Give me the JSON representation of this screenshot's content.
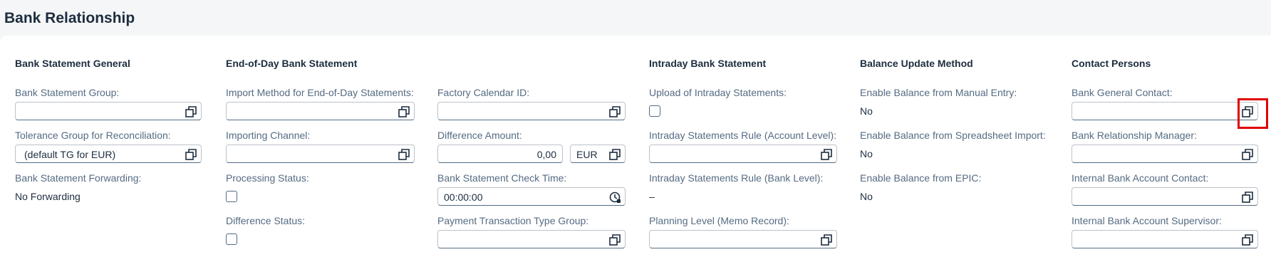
{
  "page": {
    "title": "Bank Relationship"
  },
  "sections": {
    "bank_statement_general": {
      "title": "Bank Statement General",
      "group_label": "Bank Statement Group:",
      "group_value": "",
      "tolerance_label": "Tolerance Group for Reconciliation:",
      "tolerance_value": "(default TG for EUR)",
      "forwarding_label": "Bank Statement Forwarding:",
      "forwarding_value": "No Forwarding"
    },
    "end_of_day": {
      "title": "End-of-Day Bank Statement",
      "import_method_label": "Import Method for End-of-Day Statements:",
      "import_method_value": "",
      "importing_channel_label": "Importing Channel:",
      "importing_channel_value": "",
      "processing_status_label": "Processing Status:",
      "difference_status_label": "Difference Status:",
      "factory_calendar_label": "Factory Calendar ID:",
      "factory_calendar_value": "",
      "difference_amount_label": "Difference Amount:",
      "difference_amount_value": "0,00",
      "currency_value": "EUR",
      "check_time_label": "Bank Statement Check Time:",
      "check_time_value": "00:00:00",
      "payment_type_group_label": "Payment Transaction Type Group:",
      "payment_type_group_value": ""
    },
    "intraday": {
      "title": "Intraday Bank Statement",
      "upload_label": "Upload of Intraday Statements:",
      "rule_account_label": "Intraday Statements Rule (Account Level):",
      "rule_account_value": "",
      "rule_bank_label": "Intraday Statements Rule (Bank Level):",
      "rule_bank_value": "–",
      "planning_level_label": "Planning Level (Memo Record):",
      "planning_level_value": ""
    },
    "balance_update": {
      "title": "Balance Update Method",
      "manual_label": "Enable Balance from Manual Entry:",
      "manual_value": "No",
      "spreadsheet_label": "Enable Balance from Spreadsheet Import:",
      "spreadsheet_value": "No",
      "epic_label": "Enable Balance from EPIC:",
      "epic_value": "No"
    },
    "contact_persons": {
      "title": "Contact Persons",
      "general_contact_label": "Bank General Contact:",
      "general_contact_value": "",
      "relationship_manager_label": "Bank Relationship Manager:",
      "relationship_manager_value": "",
      "internal_contact_label": "Internal Bank Account Contact:",
      "internal_contact_value": "",
      "internal_supervisor_label": "Internal Bank Account Supervisor:",
      "internal_supervisor_value": ""
    }
  },
  "icons": {
    "value_help": "value-help-icon",
    "time_picker": "clock-icon"
  },
  "colors": {
    "highlight": "#e00000",
    "accent": "#0a6ed1"
  }
}
